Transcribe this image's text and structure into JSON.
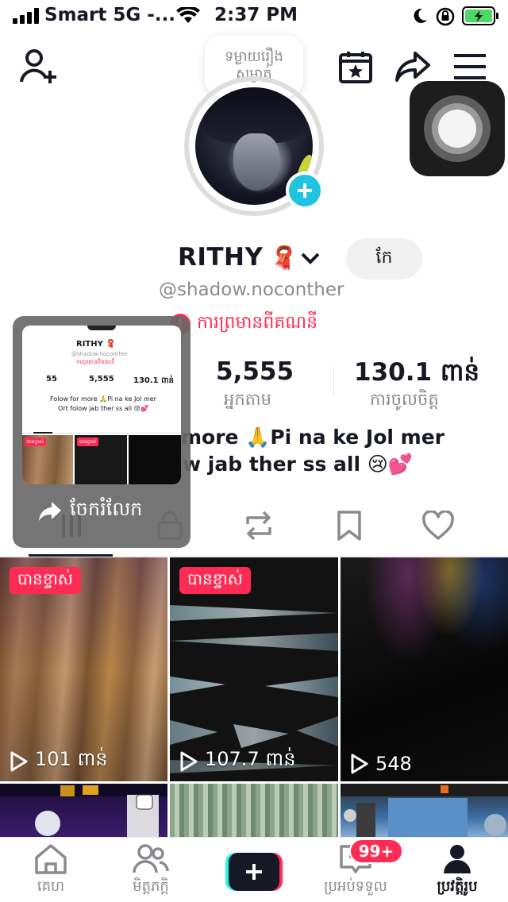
{
  "status_bar": {
    "carrier": "Smart 5G -...",
    "time": "2:37 PM"
  },
  "profile": {
    "note": "ទម្លាយរឿងសម្ងាត់",
    "name": "RITHY",
    "name_emoji": "🧣",
    "edit_label": "កែ",
    "username": "@shadow.noconther",
    "warning": "ការព្រមានពីគណនី",
    "warning_icon": "!",
    "stats": [
      {
        "value": "5,555",
        "label": "អ្នកតាម"
      },
      {
        "value": "130.1 ពាន់",
        "label": "ការចូលចិត្ត"
      }
    ],
    "bio_line1": "more 🙏Pi na ke Jol mer",
    "bio_line2": "w jab ther ss all 😢💕"
  },
  "videos": [
    {
      "pinned": true,
      "pin_label": "បានខ្ទាស់",
      "views": "101 ពាន់"
    },
    {
      "pinned": true,
      "pin_label": "បានខ្ទាស់",
      "views": "107.7 ពាន់"
    },
    {
      "pinned": false,
      "views": "548"
    }
  ],
  "share_popup": {
    "label": "ចែករំលែក",
    "thumb": {
      "name": "RITHY 🧣",
      "username": "@shadow.noconther",
      "warning": "ការព្រមានពីគណនី",
      "stat1": "55",
      "stat2": "5,555",
      "stat3": "130.1 ពាន់",
      "bio1": "Folow for more 🙏Pi na ke Jol mer",
      "bio2": "Ort folow jab ther ss all 😢💕",
      "pin": "បានខ្ទាស់"
    }
  },
  "bottom_nav": {
    "home": "គេហ",
    "friends": "មិត្តភក្តិ",
    "inbox": "ប្រអប់ទទួល",
    "inbox_badge": "99+",
    "profile": "ប្រវត្តិរូប"
  },
  "colors": {
    "accent": "#fe2c55",
    "plus_badge": "#20c4e0",
    "text": "#161823",
    "secondary_text": "#8a8b91"
  }
}
